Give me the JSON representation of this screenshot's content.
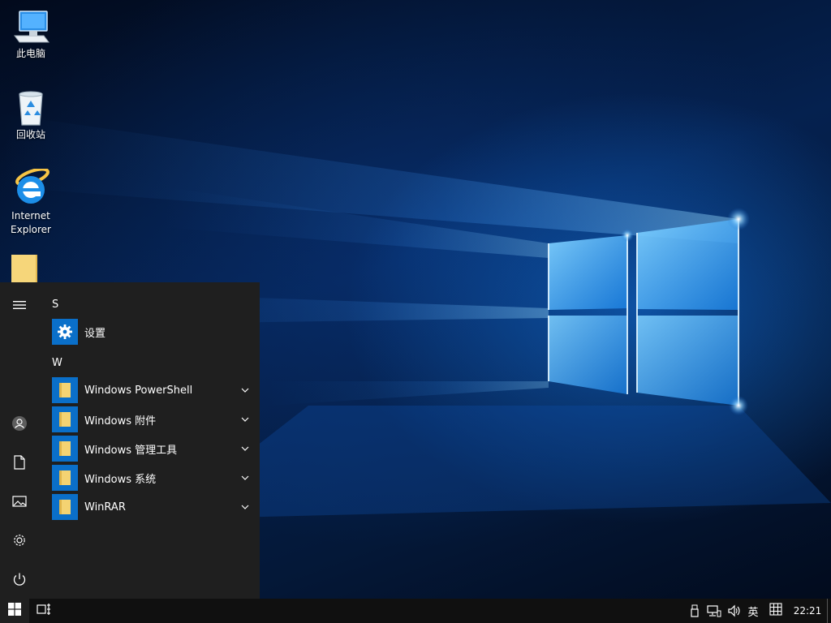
{
  "desktop": {
    "icons": [
      {
        "label": "此电脑",
        "icon": "this-pc-icon"
      },
      {
        "label": "回收站",
        "icon": "recycle-bin-icon"
      },
      {
        "label_line1": "Internet",
        "label_line2": "Explorer",
        "icon": "internet-explorer-icon"
      },
      {
        "label": "",
        "icon": "folder-icon"
      }
    ]
  },
  "start_menu": {
    "rail": [
      "hamburger-menu-icon",
      "user-account-icon",
      "documents-icon",
      "pictures-icon",
      "settings-icon",
      "power-icon"
    ],
    "groups": [
      {
        "letter": "S",
        "items": [
          {
            "label": "设置",
            "icon": "gear-icon",
            "expandable": false
          }
        ]
      },
      {
        "letter": "W",
        "items": [
          {
            "label": "Windows PowerShell",
            "icon": "folder-icon",
            "expandable": true
          },
          {
            "label": "Windows 附件",
            "icon": "folder-icon",
            "expandable": true
          },
          {
            "label": "Windows 管理工具",
            "icon": "folder-icon",
            "expandable": true
          },
          {
            "label": "Windows 系统",
            "icon": "folder-icon",
            "expandable": true
          },
          {
            "label": "WinRAR",
            "icon": "folder-icon",
            "expandable": true
          }
        ]
      }
    ]
  },
  "taskbar": {
    "start_icon": "windows-logo-icon",
    "task_view_icon": "task-view-icon",
    "tray": {
      "icons": [
        "usb-drive-icon",
        "network-icon",
        "volume-icon"
      ],
      "ime_label": "英",
      "ime_mode_icon": "ime-mode-icon",
      "clock": "22:21"
    }
  },
  "colors": {
    "accent": "#0a6fc9",
    "start_bg": "#1f1f1f",
    "taskbar_bg": "#101010",
    "folder": "#f4d372"
  }
}
